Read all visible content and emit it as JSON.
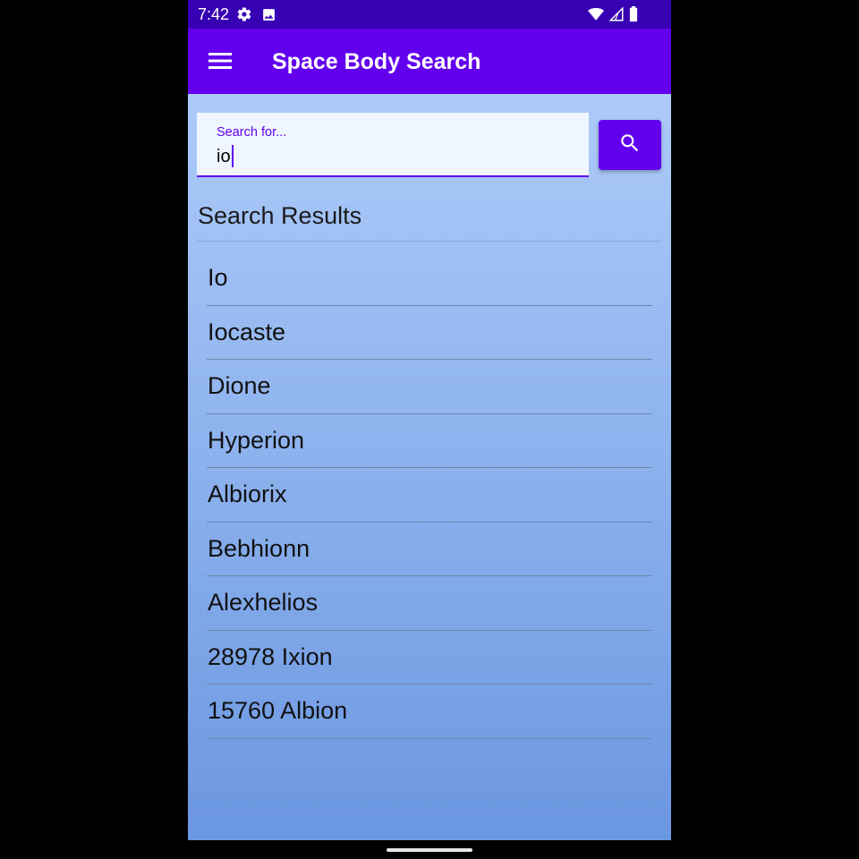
{
  "status_bar": {
    "time": "7:42",
    "left_icons": [
      "gear-icon",
      "image-icon"
    ],
    "right_icons": [
      "wifi-icon",
      "signal-icon",
      "battery-icon"
    ],
    "background": "#3700b3"
  },
  "app_bar": {
    "title": "Space Body Search",
    "menu_icon": "hamburger-menu-icon",
    "background": "#6200ee"
  },
  "search": {
    "label": "Search for...",
    "value": "io",
    "button_icon": "search-icon",
    "accent": "#6200ee"
  },
  "results": {
    "heading": "Search Results",
    "items": [
      "Io",
      "Iocaste",
      "Dione",
      "Hyperion",
      "Albiorix",
      "Bebhionn",
      "Alexhelios",
      "28978 Ixion",
      "15760 Albion"
    ]
  },
  "colors": {
    "gradient_top": "#adcbf9",
    "gradient_bottom": "#6b97e1"
  }
}
